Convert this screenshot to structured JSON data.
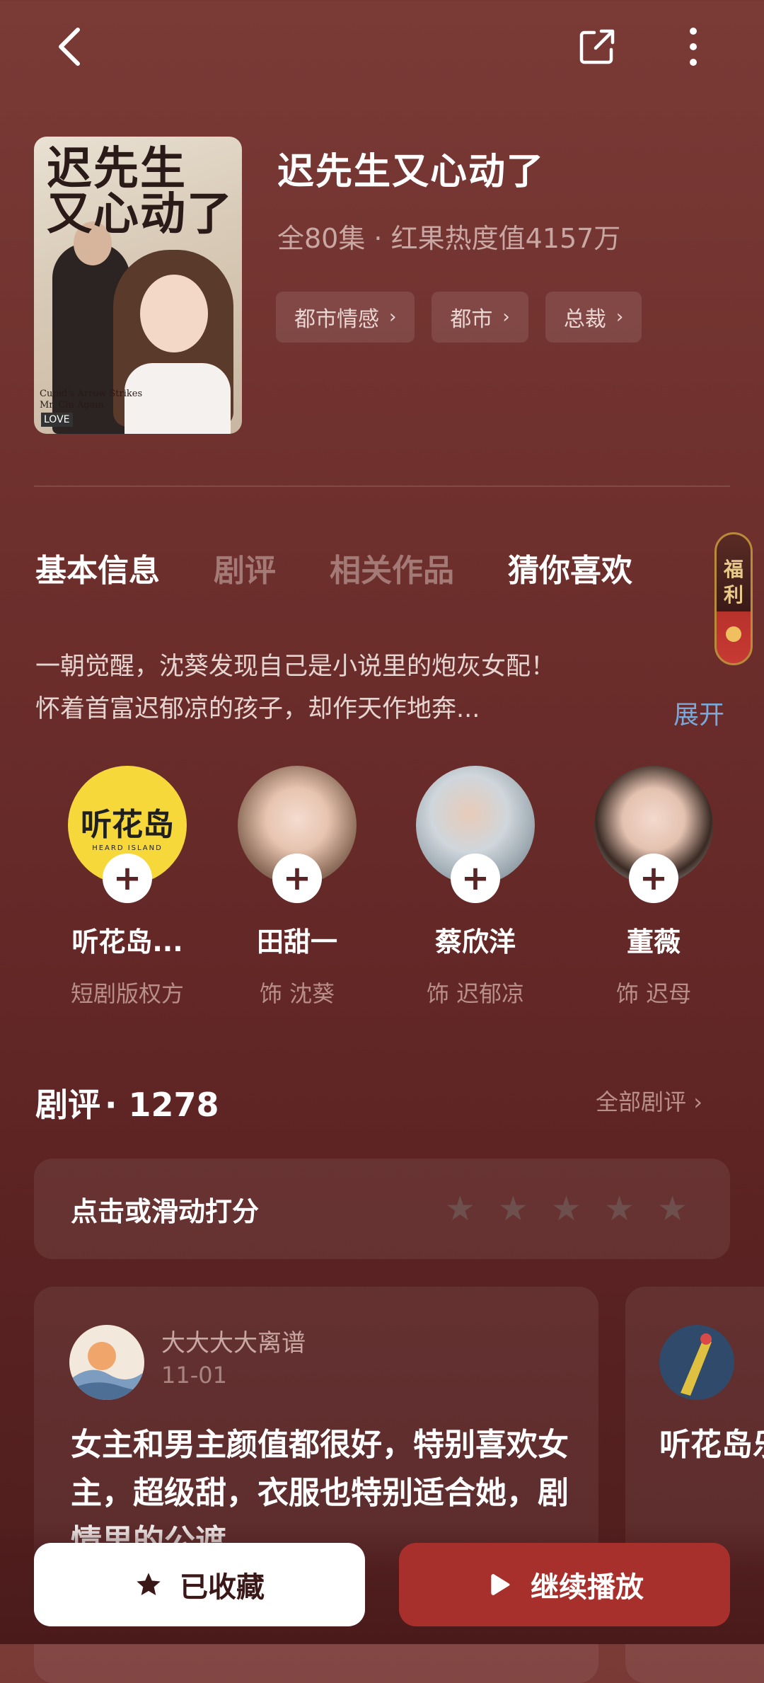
{
  "drama": {
    "title": "迟先生又心动了",
    "meta": "全80集 · 红果热度值4157万",
    "poster": {
      "title_line1": "迟先生",
      "title_line2": "又心动了",
      "english": "Cupid's Arrow Strikes Mr. Chi Again",
      "stamp": "LOVE"
    },
    "tags": [
      {
        "label": "都市情感"
      },
      {
        "label": "都市"
      },
      {
        "label": "总裁"
      }
    ]
  },
  "tabs": [
    {
      "label": "基本信息"
    },
    {
      "label": "剧评"
    },
    {
      "label": "相关作品"
    },
    {
      "label": "猜你喜欢"
    }
  ],
  "fuli": {
    "char1": "福",
    "char2": "利"
  },
  "synopsis": {
    "line1": "一朝觉醒，沈葵发现自己是小说里的炮灰女配！",
    "line2": "怀着首富迟郁凉的孩子，却作天作地奔...",
    "expand_label": "展开"
  },
  "cast": [
    {
      "name": "听花岛...",
      "role": "短剧版权方",
      "logo_text": "听花岛",
      "logo_sub": "HEARD ISLAND"
    },
    {
      "name": "田甜一",
      "role": "饰 沈葵"
    },
    {
      "name": "蔡欣洋",
      "role": "饰 迟郁凉"
    },
    {
      "name": "董薇",
      "role": "饰 迟母"
    }
  ],
  "reviews": {
    "heading": "剧评",
    "count": "· 1278",
    "all_label": "全部剧评",
    "rate_label": "点击或滑动打分",
    "cards": [
      {
        "user": "大大大大离谱",
        "date": "11-01",
        "text": "女主和男主颜值都很好，特别喜欢女主，超级甜，衣服也特别适合她，剧情里的公遮"
      },
      {
        "user": "",
        "date": "",
        "text": "听花岛乐的小蔡欣洋"
      }
    ]
  },
  "actions": {
    "favorite_label": "已收藏",
    "play_label": "继续播放"
  },
  "colors": {
    "background": "#6d2f2c",
    "play_button": "#a8302c",
    "link": "#7aa8d8"
  }
}
